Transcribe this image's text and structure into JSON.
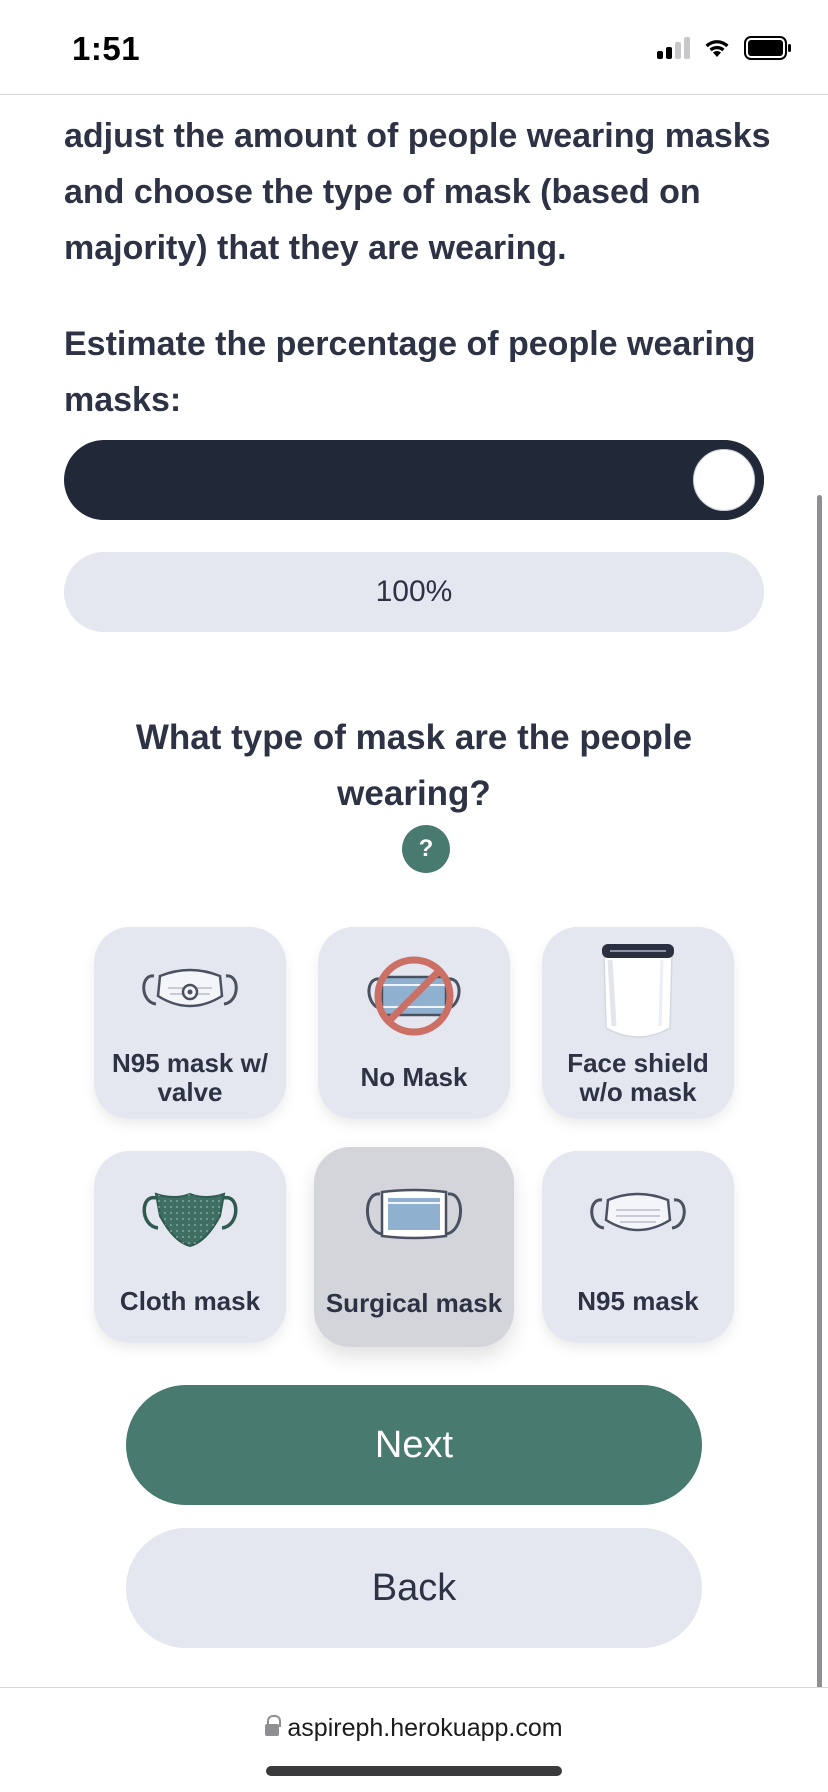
{
  "status_bar": {
    "time": "1:51"
  },
  "intro": {
    "text": "adjust the amount of people wearing masks and choose the type of mask (based on majority) that they are wearing."
  },
  "question_percentage": {
    "label": "Estimate the percentage of people wearing masks:",
    "slider_value_percent": 100,
    "value_text": "100%"
  },
  "question_mask_type": {
    "label": "What type of mask are the people wearing?",
    "help_label": "?"
  },
  "mask_options": [
    {
      "label": "N95 mask w/ valve",
      "icon": "n95-valve-mask-icon",
      "selected": false
    },
    {
      "label": "No Mask",
      "icon": "no-mask-icon",
      "selected": false
    },
    {
      "label": "Face shield w/o mask",
      "icon": "face-shield-icon",
      "selected": false
    },
    {
      "label": "Cloth mask",
      "icon": "cloth-mask-icon",
      "selected": false
    },
    {
      "label": "Surgical mask",
      "icon": "surgical-mask-icon",
      "selected": true
    },
    {
      "label": "N95 mask",
      "icon": "n95-mask-icon",
      "selected": false
    }
  ],
  "buttons": {
    "next": "Next",
    "back": "Back"
  },
  "browser": {
    "url": "aspireph.herokuapp.com"
  },
  "colors": {
    "accent": "#487a70",
    "dark": "#212838",
    "card": "#e4e6f0",
    "selected_card": "#d3d5db",
    "text": "#2d3344"
  }
}
